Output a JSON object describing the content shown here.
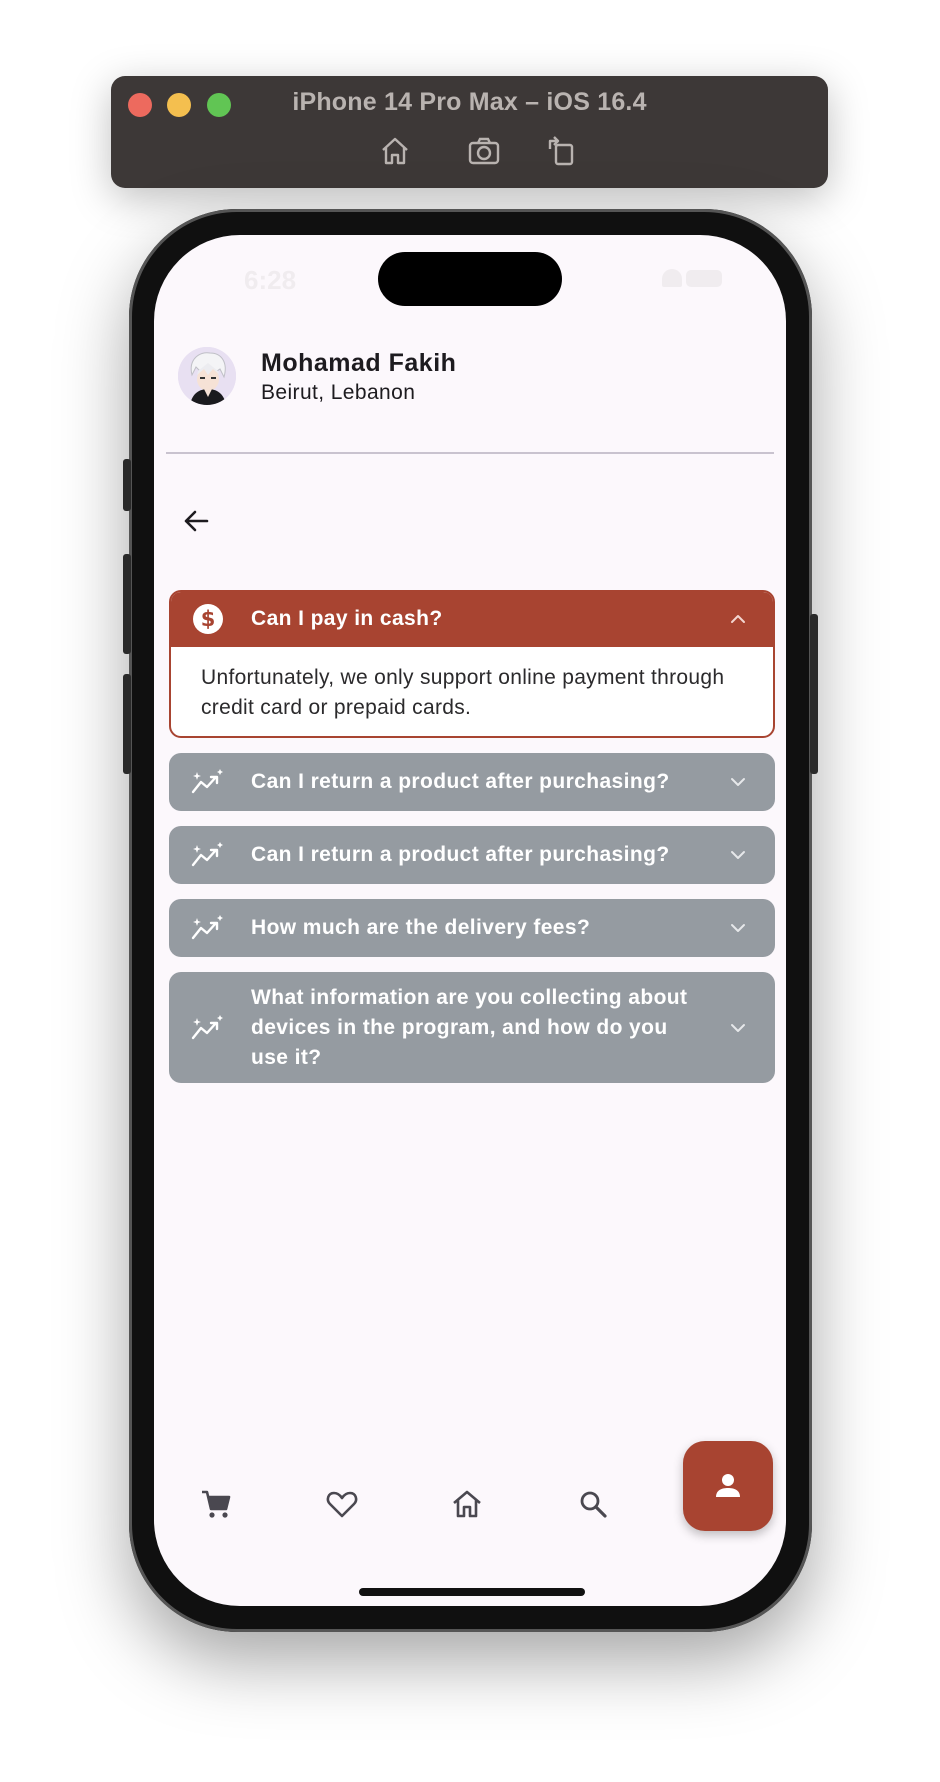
{
  "simulator": {
    "title": "iPhone 14 Pro Max – iOS 16.4",
    "tools": [
      "home-icon",
      "screenshot-icon",
      "rotate-icon"
    ]
  },
  "status_bar": {
    "time": "6:28"
  },
  "profile": {
    "name": "Mohamad Fakih",
    "location": "Beirut, Lebanon"
  },
  "faq": {
    "items": [
      {
        "question": "Can I pay in cash?",
        "answer": "Unfortunately, we only support online payment through credit card or prepaid cards.",
        "icon": "dollar-circle-icon",
        "expanded": true
      },
      {
        "question": "Can I return a product after purchasing?",
        "icon": "trending-sparkle-icon",
        "expanded": false
      },
      {
        "question": "Can I return a product after purchasing?",
        "icon": "trending-sparkle-icon",
        "expanded": false
      },
      {
        "question": "How much are the delivery fees?",
        "icon": "trending-sparkle-icon",
        "expanded": false
      },
      {
        "question": "What information are you collecting about devices in the program, and how do you use it?",
        "icon": "trending-sparkle-icon",
        "expanded": false
      }
    ]
  },
  "bottom_nav": {
    "items": [
      "cart-icon",
      "heart-icon",
      "home-icon",
      "search-icon",
      "person-icon"
    ],
    "selected": "person-icon"
  },
  "colors": {
    "accent": "#a84431",
    "collapsed_item": "#959ba1",
    "background": "#fcf8fc"
  }
}
